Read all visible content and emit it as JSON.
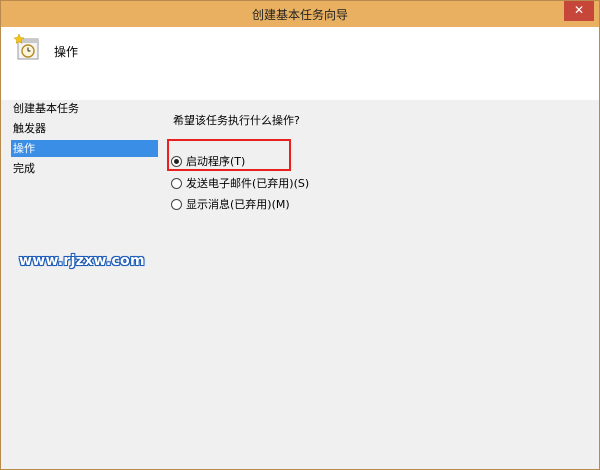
{
  "window": {
    "title": "创建基本任务向导",
    "close_glyph": "✕"
  },
  "header": {
    "title": "操作",
    "icon": "task-clock-icon"
  },
  "sidebar": {
    "items": [
      {
        "label": "创建基本任务",
        "active": false
      },
      {
        "label": "触发器",
        "active": false
      },
      {
        "label": "操作",
        "active": true
      },
      {
        "label": "完成",
        "active": false
      }
    ]
  },
  "main": {
    "question": "希望该任务执行什么操作?",
    "options": [
      {
        "label": "启动程序(T)",
        "checked": true
      },
      {
        "label": "发送电子邮件(已弃用)(S)",
        "checked": false
      },
      {
        "label": "显示消息(已弃用)(M)",
        "checked": false
      }
    ]
  },
  "watermark": {
    "text": "www.rjzxw.com"
  },
  "colors": {
    "titlebar": "#e8b060",
    "close": "#c7463a",
    "selection": "#3a8ee6",
    "highlight": "#e8201e",
    "watermark_outline": "#1c5bb8"
  }
}
